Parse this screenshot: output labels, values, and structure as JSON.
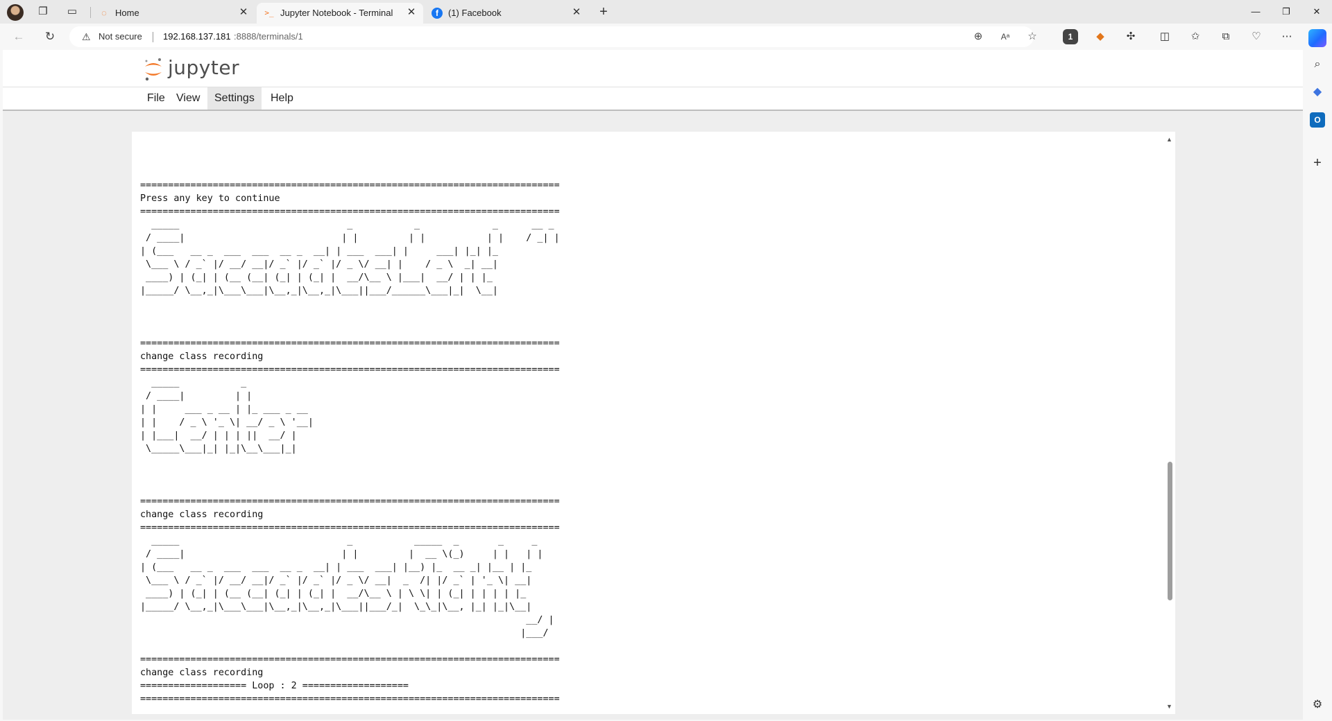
{
  "browser": {
    "tabs": [
      {
        "title": "Home",
        "icon": "jupyter-icon",
        "active": false
      },
      {
        "title": "Jupyter Notebook - Terminal",
        "icon": "terminal-icon",
        "active": true
      },
      {
        "title": "(1) Facebook",
        "icon": "facebook-icon",
        "active": false
      }
    ],
    "new_tab_label": "+",
    "security_label": "Not secure",
    "url_host": "192.168.137.181",
    "url_rest": ":8888/terminals/1"
  },
  "jupyter": {
    "logo_text": "jupyter",
    "menu": [
      "File",
      "View",
      "Settings",
      "Help"
    ],
    "open_menu": "Settings"
  },
  "terminal": {
    "scroll_fraction": 0.76,
    "thumb_fraction": 0.25,
    "lines": [
      "===========================================================================",
      "Press any key to continue",
      "===========================================================================",
      "  _____                              _           _             _      __ _",
      " / ____|                            | |         | |           | |    / _| |",
      "| (___   __ _  ___  ___  __ _  __| | ___  ___| |     ___| |_| |_",
      " \\___ \\ / _` |/ __/ __|/ _` |/ _` |/ _ \\/ __| |    / _ \\  _| __|",
      " ____) | (_| | (__ (__| (_| | (_| |  __/\\__ \\ |___|  __/ | | |_",
      "|_____/ \\__,_|\\___\\___|\\__,_|\\__,_|\\___||___/______\\___|_|  \\__|",
      "",
      "",
      "",
      "===========================================================================",
      "change class recording",
      "===========================================================================",
      "  _____           _",
      " / ____|         | |",
      "| |     ___ _ __ | |_ ___ _ __",
      "| |    / _ \\ '_ \\| __/ _ \\ '__|",
      "| |___|  __/ | | | ||  __/ |",
      " \\_____\\___|_| |_|\\__\\___|_|",
      "",
      "",
      "",
      "===========================================================================",
      "change class recording",
      "===========================================================================",
      "  _____                              _           _____  _       _     _",
      " / ____|                            | |         |  __ \\(_)     | |   | |",
      "| (___   __ _  ___  ___  __ _  __| | ___  ___| |__) |_  __ _| |__ | |_",
      " \\___ \\ / _` |/ __/ __|/ _` |/ _` |/ _ \\/ __|  _  /| |/ _` | '_ \\| __|",
      " ____) | (_| | (__ (__| (_| | (_| |  __/\\__ \\ | \\ \\| | (_| | | | | |_",
      "|_____/ \\__,_|\\___\\___|\\__,_|\\__,_|\\___||___/_|  \\_\\_|\\__, |_| |_|\\__|",
      "                                                                     __/ |",
      "                                                                    |___/",
      "",
      "===========================================================================",
      "change class recording",
      "=================== Loop : 2 ===================",
      "==========================================================================="
    ]
  }
}
